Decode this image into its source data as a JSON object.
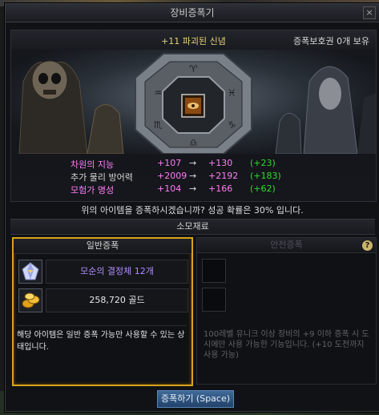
{
  "window": {
    "title": "장비증폭기",
    "close_label": "×"
  },
  "item": {
    "name": "+11 파괴된 신념",
    "protection_status": "증폭보호권 0개 보유"
  },
  "stats": [
    {
      "label": "차원의 지능",
      "label_color": "#ff7df4",
      "current": "+107",
      "arrow": "→",
      "new": "+130",
      "diff": "(+23)"
    },
    {
      "label": "추가 물리 방어력",
      "label_color": "#d8d8d8",
      "current": "+2009",
      "arrow": "→",
      "new": "+2192",
      "diff": "(+183)"
    },
    {
      "label": "모험가 명성",
      "label_color": "#ff7df4",
      "current": "+104",
      "arrow": "→",
      "new": "+166",
      "diff": "(+62)"
    }
  ],
  "prompt": "위의 아이템을 증폭하시겠습니까? 성공 확률은 30% 입니다.",
  "materials_header": "소모재료",
  "normal": {
    "title": "일반증폭",
    "items": [
      {
        "text": "모순의 결정체 12개",
        "icon": "crystal-icon",
        "color": "#b28cff"
      },
      {
        "text": "258,720 골드",
        "icon": "gold-coins-icon",
        "color": "#e8e8e8"
      }
    ],
    "description": "해당 아이템은 일반 증폭 가능만 사용할 수 있는 상태입니다."
  },
  "safe": {
    "title": "안전증폭",
    "help_label": "?",
    "description": "100레벨 유니크 이상 장비의 +9 이하 증폭 시 도 시에만 사용 가능한 기능입니다. (+10 도전까지 사용 가능)"
  },
  "button": {
    "label": "증폭하기 (Space)"
  },
  "colors": {
    "accent_gold": "#d9a21a",
    "stat_magenta": "#ff7df4",
    "diff_green": "#31d931",
    "button_blue": "#3f6a98"
  }
}
